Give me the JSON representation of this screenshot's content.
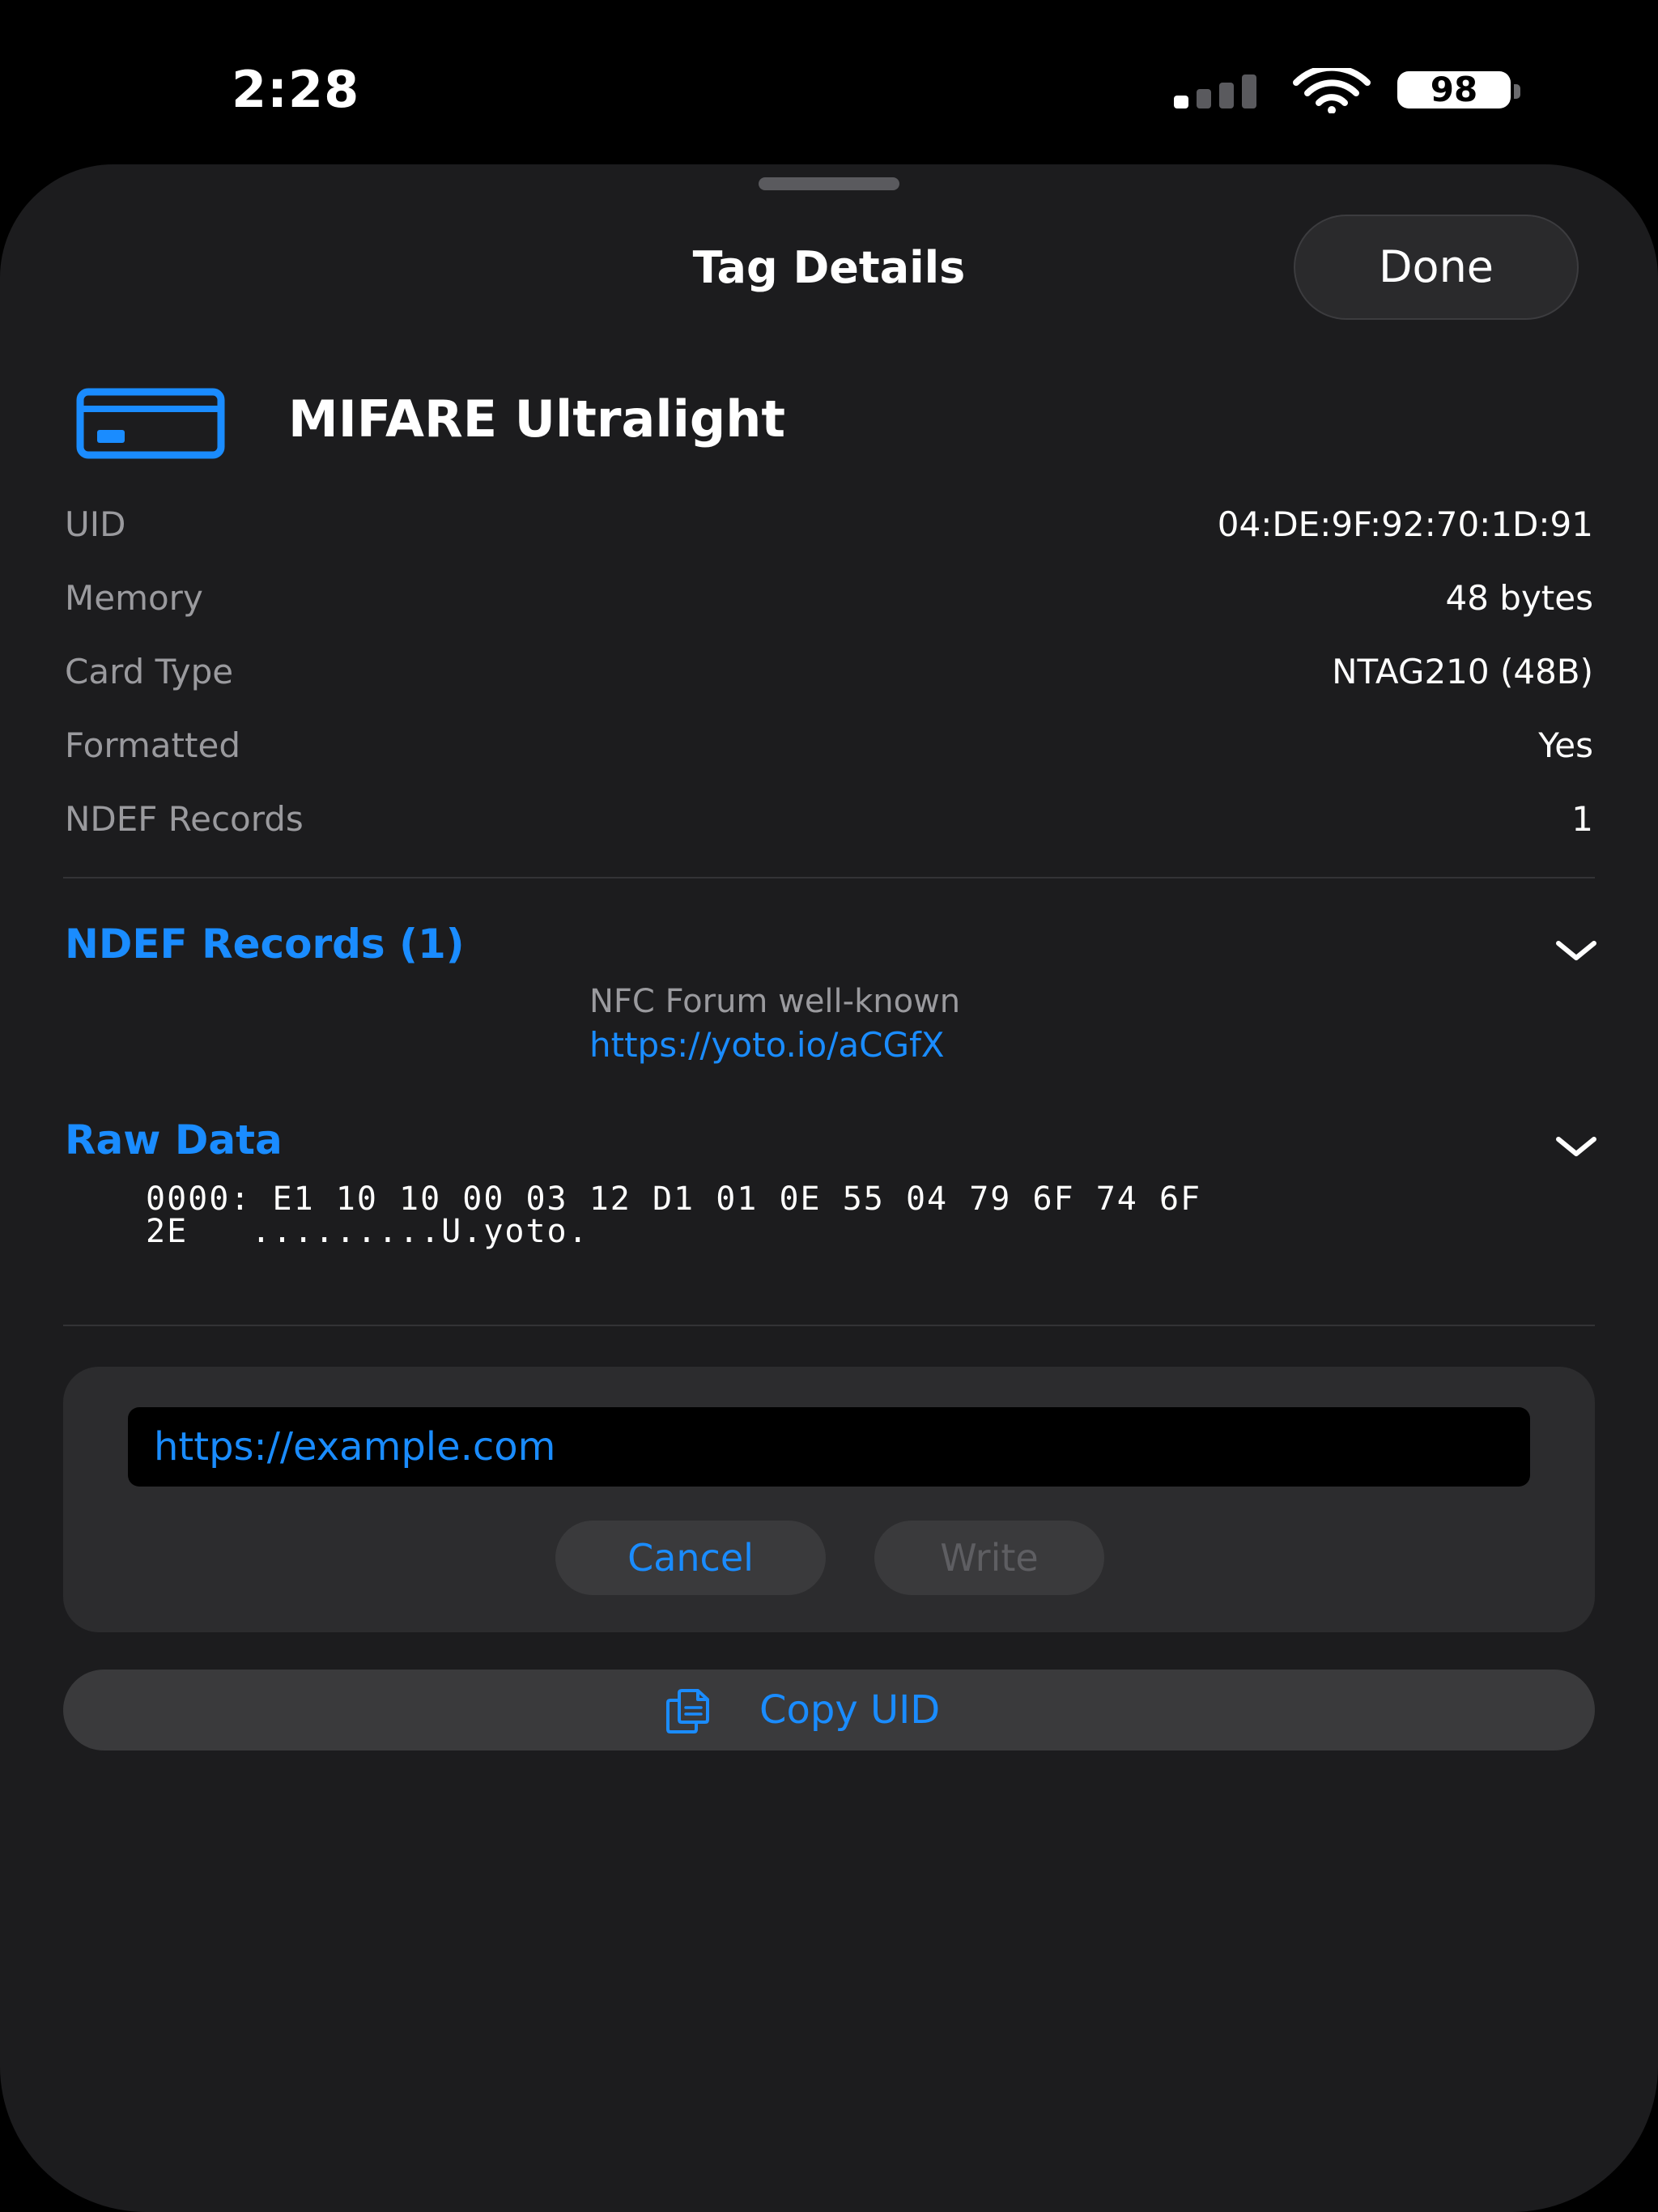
{
  "status_bar": {
    "time": "2:28",
    "battery_level": "98",
    "signal_strength_bars": 1
  },
  "sheet": {
    "title": "Tag Details",
    "done_label": "Done"
  },
  "tag": {
    "icon": "card-icon",
    "type": "MIFARE Ultralight",
    "details": [
      {
        "label": "UID",
        "value": "04:DE:9F:92:70:1D:91"
      },
      {
        "label": "Memory",
        "value": "48 bytes"
      },
      {
        "label": "Card Type",
        "value": "NTAG210 (48B)"
      },
      {
        "label": "Formatted",
        "value": "Yes"
      },
      {
        "label": "NDEF Records",
        "value": "1"
      }
    ]
  },
  "ndef_section": {
    "title": "NDEF Records (1)",
    "records": [
      {
        "type": "NFC Forum well-known",
        "value": "https://yoto.io/aCGfX"
      }
    ]
  },
  "raw_section": {
    "title": "Raw Data",
    "lines": [
      "0000: E1 10 10 00 03 12 D1 01 0E 55 04 79 6F 74 6F",
      "2E   .........U.yoto."
    ]
  },
  "write_panel": {
    "input_value": "https://example.com",
    "cancel_label": "Cancel",
    "write_label": "Write"
  },
  "copy_uid_label": "Copy UID",
  "colors": {
    "accent": "#1a8cff",
    "sheet_background": "#1c1c1e",
    "secondary_text": "#9a9a9e"
  }
}
